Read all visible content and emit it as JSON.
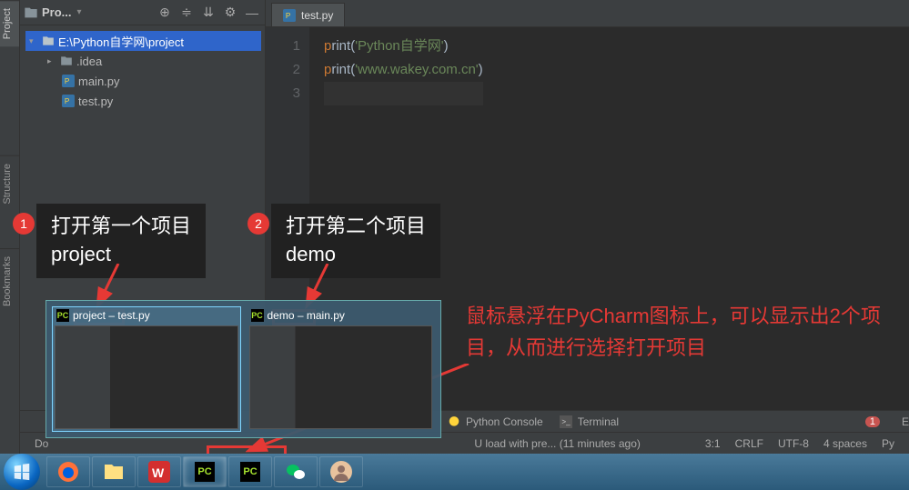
{
  "sidebar": {
    "tabs": [
      "Project",
      "Structure",
      "Bookmarks"
    ]
  },
  "project_panel": {
    "title": "Pro...",
    "root": "E:\\Python自学网\\project",
    "items": [
      {
        "name": ".idea",
        "type": "dir"
      },
      {
        "name": "main.py",
        "type": "py"
      },
      {
        "name": "test.py",
        "type": "py"
      }
    ]
  },
  "editor": {
    "tab_label": "test.py",
    "lines": [
      {
        "n": "1",
        "pre": "p",
        "kw": "rint",
        "par_open": "(",
        "str": "'Python自学网'",
        "par_close": ")"
      },
      {
        "n": "2",
        "pre": "p",
        "kw": "rint",
        "par_open": "(",
        "str": "'www.wakey.com.cn'",
        "par_close": ")"
      },
      {
        "n": "3",
        "pre": "",
        "kw": "",
        "par_open": "",
        "str": "",
        "par_close": ""
      }
    ]
  },
  "bottom_tabs": {
    "a": "Python Console",
    "b": "Terminal"
  },
  "status": {
    "left_prefix": "Do",
    "left_msg": "U load with pre... (11 minutes ago)",
    "pos": "3:1",
    "enc": "CRLF",
    "charset": "UTF-8",
    "indent": "4 spaces",
    "lang": "Py",
    "err": "1",
    "err_label": "E"
  },
  "annotations": {
    "a1_num": "1",
    "a1_l1": "打开第一个项目",
    "a1_l2": "project",
    "a2_num": "2",
    "a2_l1": "打开第二个项目",
    "a2_l2": "demo",
    "hover": "鼠标悬浮在PyCharm图标上，可以显示出2个项目，从而进行选择打开项目"
  },
  "thumbs": {
    "t1": "project – test.py",
    "t2": "demo – main.py"
  },
  "taskbar_icons": [
    "start",
    "firefox",
    "explorer",
    "wps",
    "pycharm",
    "wechat",
    "avatar"
  ]
}
